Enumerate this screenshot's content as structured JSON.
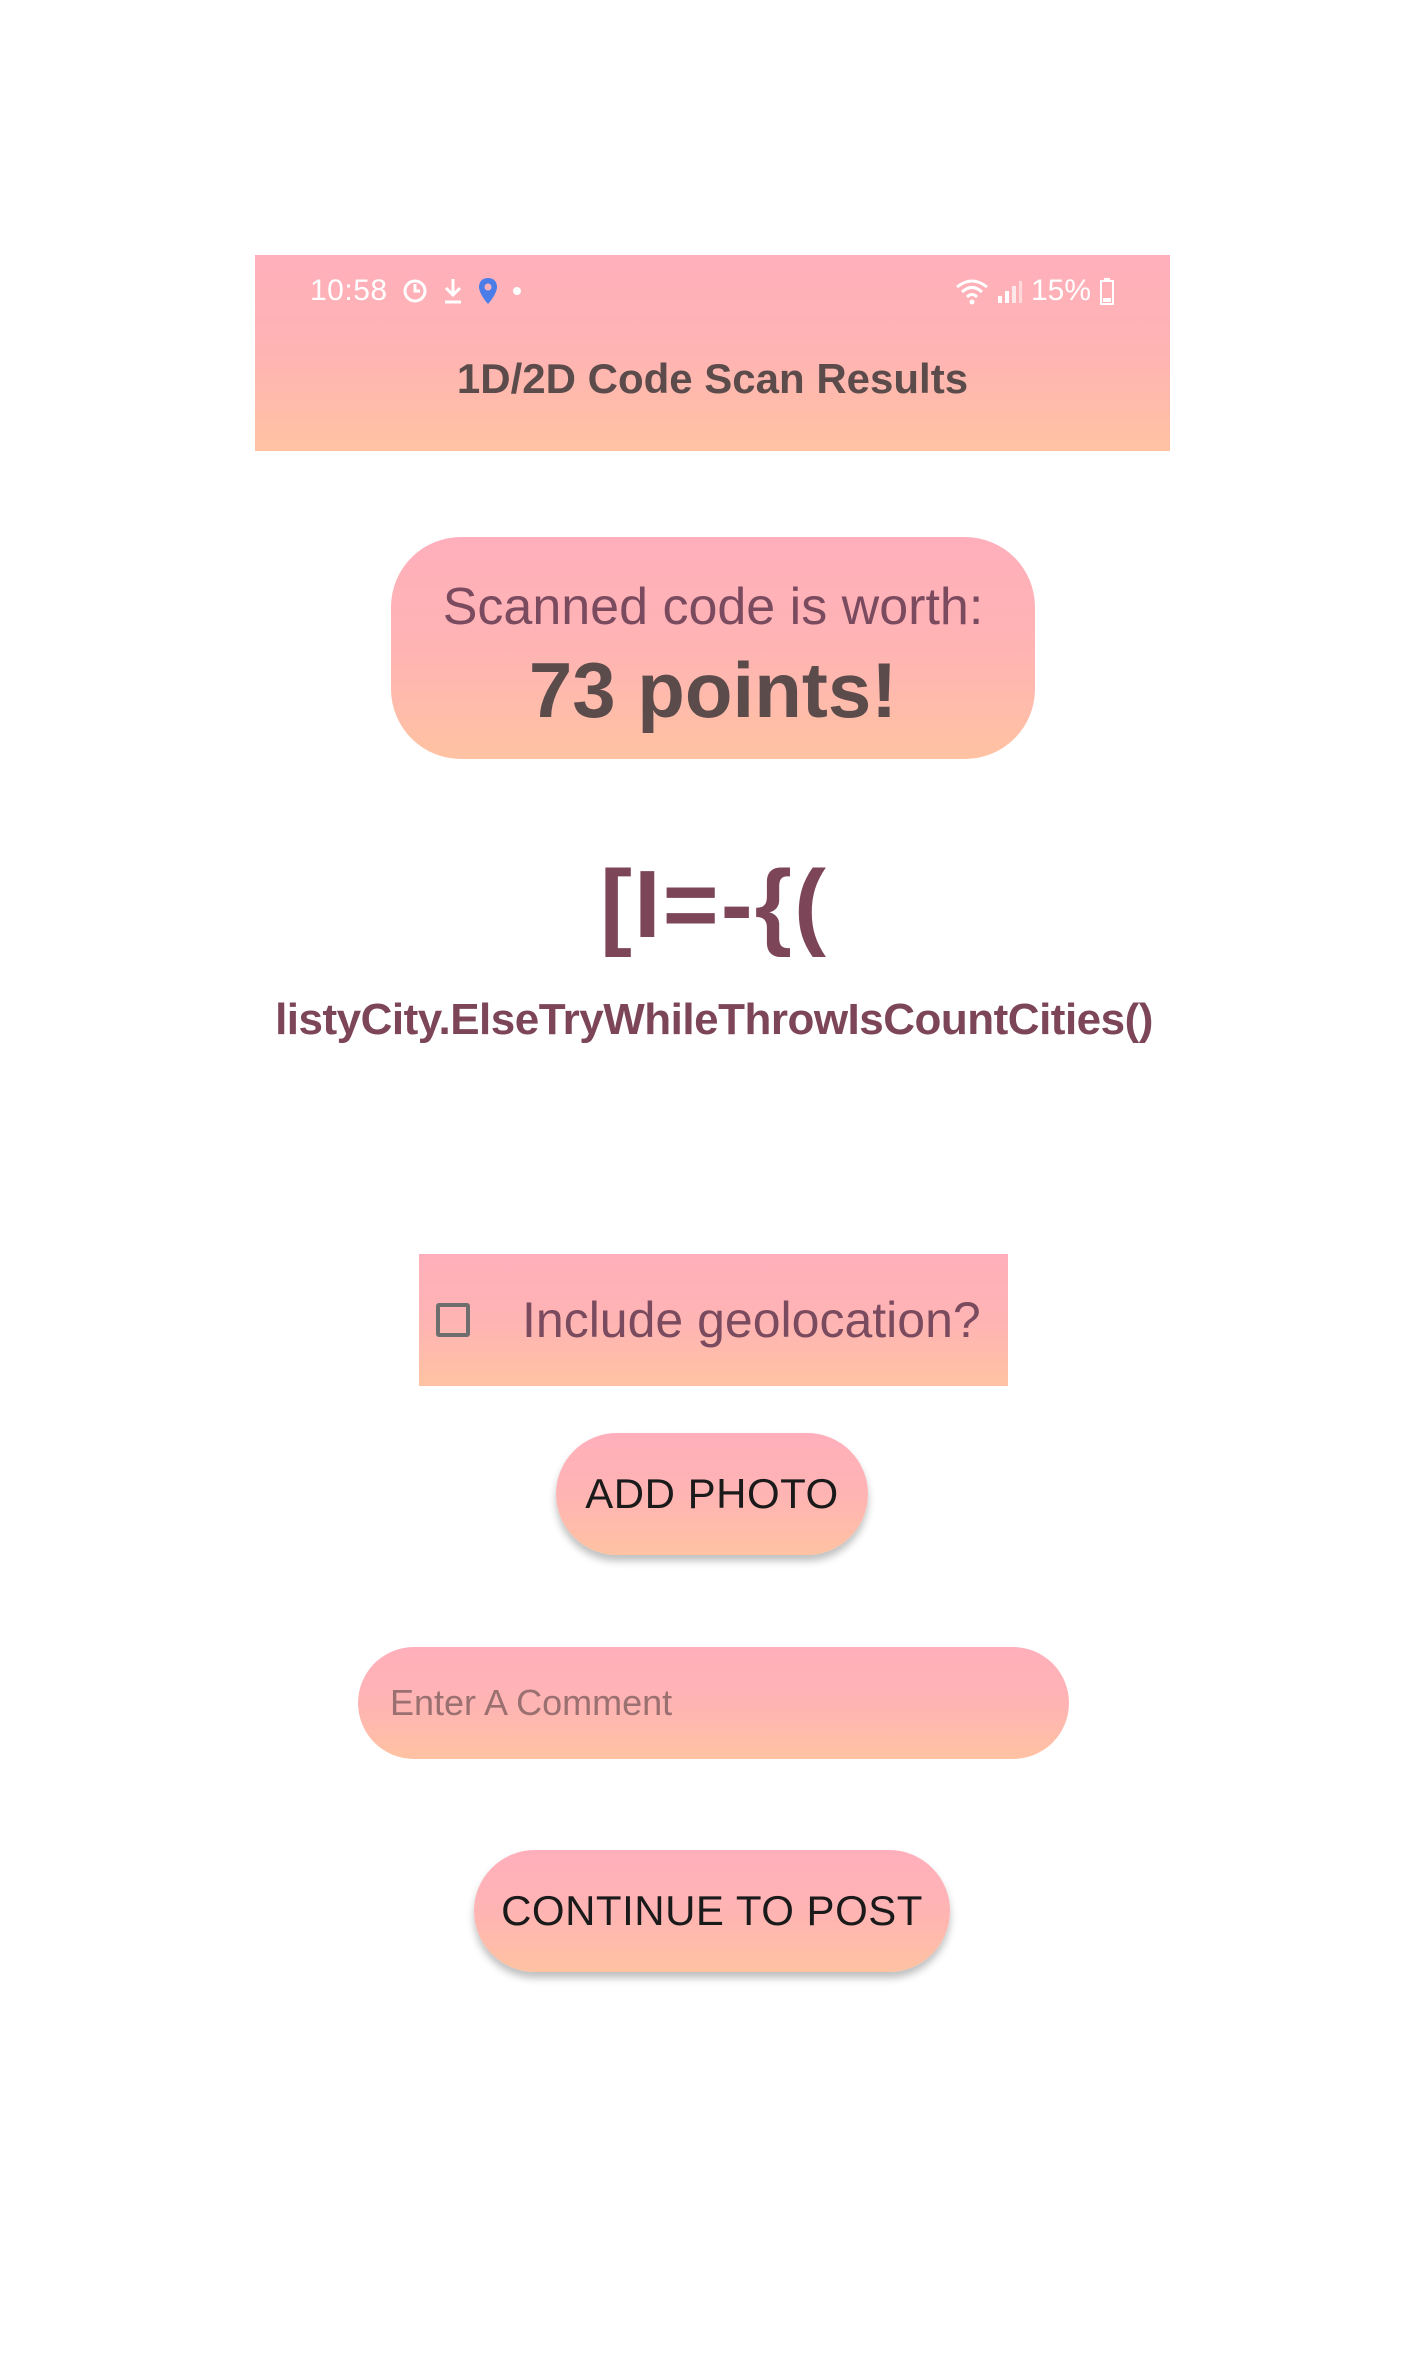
{
  "status_bar": {
    "time": "10:58",
    "battery": "15%",
    "icons_left": [
      "sync-icon",
      "download-icon",
      "location-icon",
      "dot-icon"
    ],
    "icons_right": [
      "wifi-icon",
      "signal-icon",
      "battery-icon"
    ]
  },
  "header": {
    "title": "1D/2D Code Scan Results"
  },
  "points": {
    "label": "Scanned code is worth:",
    "value": "73 points!"
  },
  "code": {
    "glyph": "[I=-{(",
    "name": "listyCity.ElseTryWhileThrowIsCountCities()"
  },
  "geolocation": {
    "label": "Include geolocation?",
    "checked": false
  },
  "buttons": {
    "add_photo": "ADD PHOTO",
    "continue": "CONTINUE TO POST"
  },
  "comment": {
    "placeholder": "Enter A Comment",
    "value": ""
  },
  "colors": {
    "gradient_top": "#ffafbb",
    "gradient_bottom": "#ffc2a2",
    "accent_text": "#7d4558",
    "title_text": "#5b4b4b",
    "location_icon": "#4a7de8"
  }
}
